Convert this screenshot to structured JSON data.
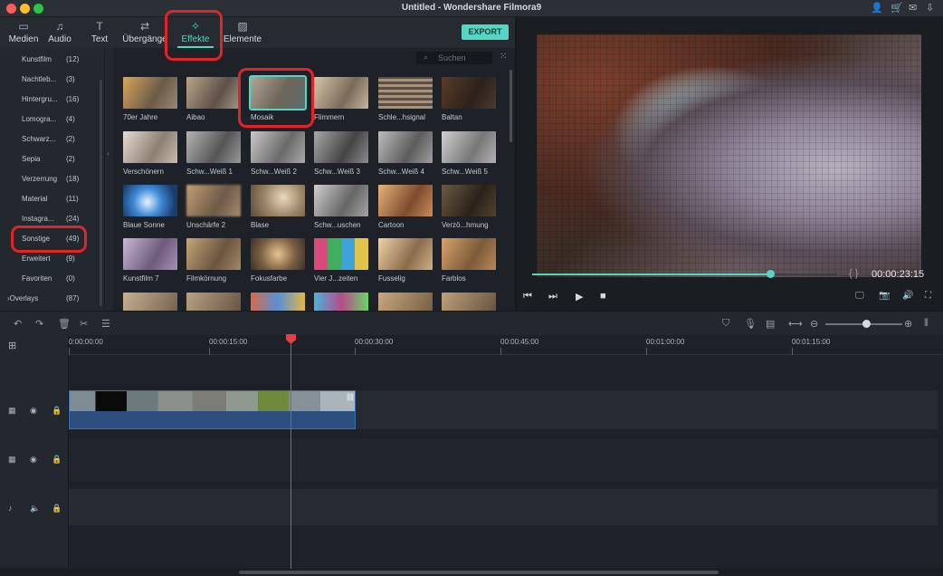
{
  "window": {
    "title": "Untitled - Wondershare Filmora9"
  },
  "tabs": [
    {
      "label": "Medien",
      "icon": "folder-icon"
    },
    {
      "label": "Audio",
      "icon": "music-note-icon"
    },
    {
      "label": "Text",
      "icon": "text-icon"
    },
    {
      "label": "Übergänge",
      "icon": "transition-icon"
    },
    {
      "label": "Effekte",
      "icon": "effects-icon"
    },
    {
      "label": "Elemente",
      "icon": "elements-icon"
    }
  ],
  "export_label": "EXPORT",
  "search": {
    "placeholder": "Suchen"
  },
  "categories": [
    {
      "name": "Kunstfilm",
      "count": "(12)"
    },
    {
      "name": "Nachtleb...",
      "count": "(3)"
    },
    {
      "name": "Hintergru...",
      "count": "(16)"
    },
    {
      "name": "Lomogra...",
      "count": "(4)"
    },
    {
      "name": "Schwarz...",
      "count": "(2)"
    },
    {
      "name": "Sepia",
      "count": "(2)"
    },
    {
      "name": "Verzerrung",
      "count": "(18)"
    },
    {
      "name": "Material",
      "count": "(11)"
    },
    {
      "name": "Instagra...",
      "count": "(24)"
    },
    {
      "name": "Sonstige",
      "count": "(49)"
    },
    {
      "name": "Erweitert",
      "count": "(9)"
    },
    {
      "name": "Favoriten",
      "count": "(0)"
    },
    {
      "name": "Overlays",
      "count": "(87)"
    }
  ],
  "effects": [
    [
      "70er Jahre",
      "Aibao",
      "Mosaik",
      "Flimmern",
      "Schle...hsignal",
      "Baltan"
    ],
    [
      "Verschönern",
      "Schw...Weiß 1",
      "Schw...Weiß 2",
      "Schw...Weiß 3",
      "Schw...Weiß 4",
      "Schw...Weiß 5"
    ],
    [
      "Blaue Sonne",
      "Unschärfe 2",
      "Blase",
      "Schw...uschen",
      "Cartoon",
      "Verzö...hmung"
    ],
    [
      "Kunstfilm 7",
      "Filmkörnung",
      "Fokusfarbe",
      "Vier J...zeiten",
      "Fusselig",
      "Farblos"
    ]
  ],
  "preview": {
    "timecode": "00:00:23:15",
    "progress": 0.78
  },
  "ruler_labels": [
    "0:00:00:00",
    "00:00:15:00",
    "00:00:30:00",
    "00:00:45:00",
    "00:01:00:00",
    "00:01:15:00"
  ],
  "zoom_level": 0.53
}
